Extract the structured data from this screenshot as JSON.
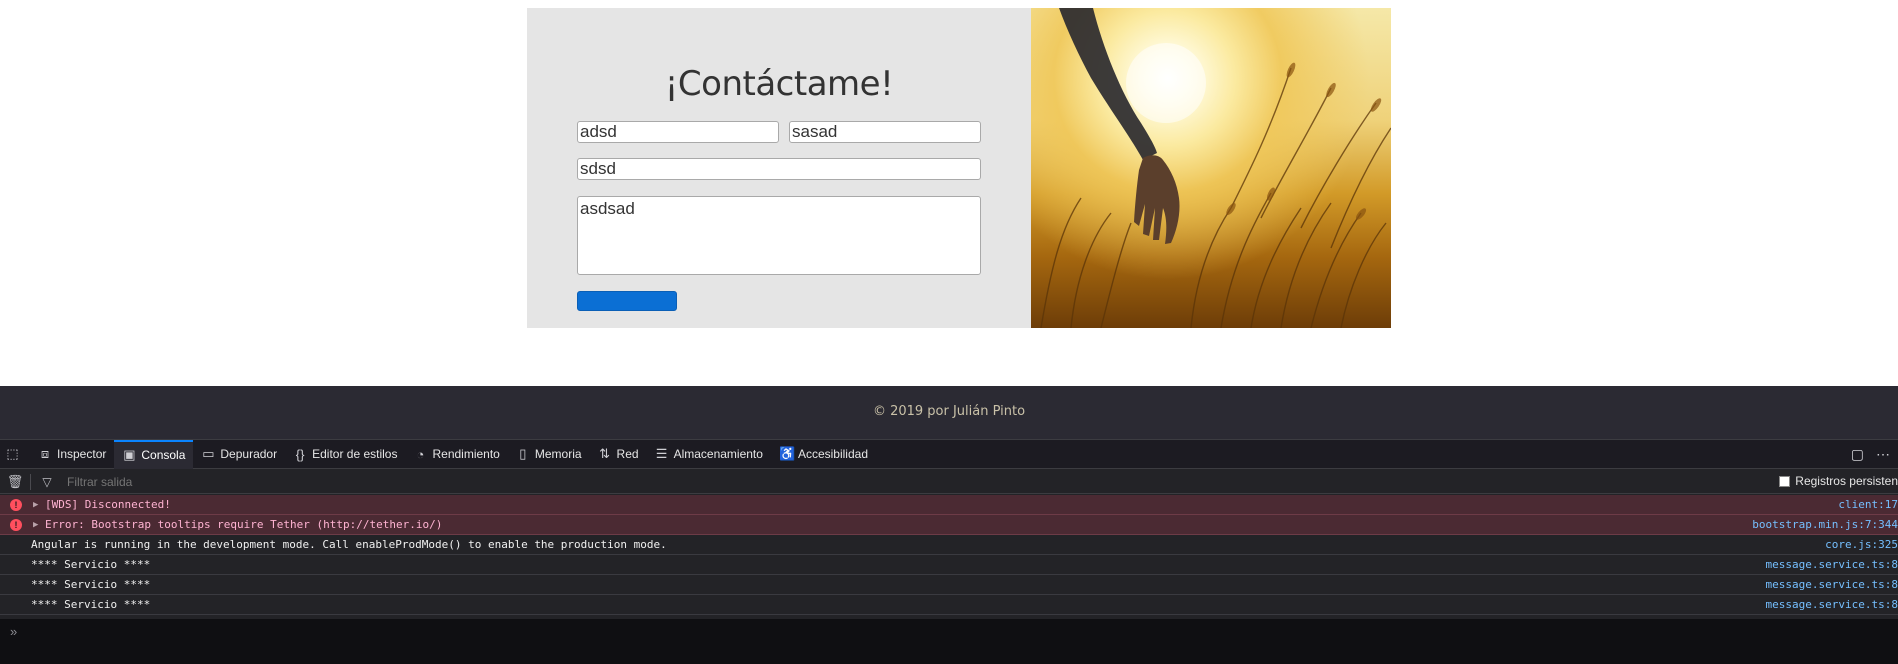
{
  "contact": {
    "title": "¡Contáctame!",
    "name_value": "adsd",
    "lastname_value": "sasad",
    "email_value": "sdsd",
    "message_value": "asdsad",
    "submit_label": ""
  },
  "footer": {
    "text": "© 2019 por Julián Pinto"
  },
  "devtools": {
    "tabs": [
      {
        "label": "Inspector",
        "icon": "inspector-icon"
      },
      {
        "label": "Consola",
        "icon": "console-icon",
        "selected": true
      },
      {
        "label": "Depurador",
        "icon": "debugger-icon"
      },
      {
        "label": "Editor de estilos",
        "icon": "braces-icon"
      },
      {
        "label": "Rendimiento",
        "icon": "gauge-icon"
      },
      {
        "label": "Memoria",
        "icon": "memory-icon"
      },
      {
        "label": "Red",
        "icon": "network-icon"
      },
      {
        "label": "Almacenamiento",
        "icon": "storage-icon"
      },
      {
        "label": "Accesibilidad",
        "icon": "accessibility-icon"
      }
    ],
    "filter_placeholder": "Filtrar salida",
    "persist_label": "Registros persisten",
    "messages": [
      {
        "type": "error",
        "text": "[WDS] Disconnected!",
        "source": "client:17"
      },
      {
        "type": "error",
        "text": "Error: Bootstrap tooltips require Tether (http://tether.io/)",
        "source": "bootstrap.min.js:7:344"
      },
      {
        "type": "log",
        "text": "Angular is running in the development mode. Call enableProdMode() to enable the production mode.",
        "source": "core.js:325"
      },
      {
        "type": "log",
        "text": "**** Servicio ****",
        "source": "message.service.ts:8"
      },
      {
        "type": "log",
        "text": "**** Servicio ****",
        "source": "message.service.ts:8"
      },
      {
        "type": "log",
        "text": "**** Servicio ****",
        "source": "message.service.ts:8"
      }
    ]
  },
  "colors": {
    "accent": "#0a84ff",
    "submit_button": "#0b6fd4",
    "form_panel": "#e5e5e5",
    "footer_bg": "#2b2a33",
    "error_row": "#4b2a33"
  }
}
